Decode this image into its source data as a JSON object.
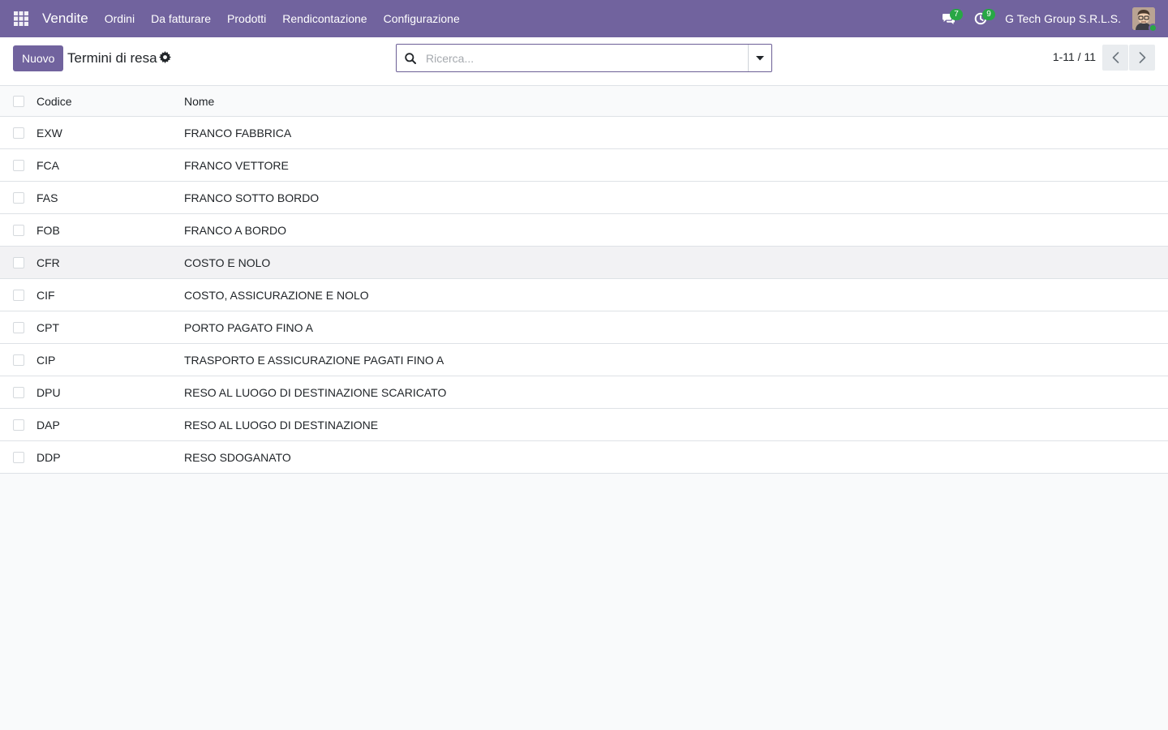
{
  "navbar": {
    "app_name": "Vendite",
    "menu": [
      "Ordini",
      "Da fatturare",
      "Prodotti",
      "Rendicontazione",
      "Configurazione"
    ],
    "messages_count": "7",
    "activities_count": "9",
    "company": "G Tech Group S.R.L.S.",
    "accent_color": "#71639e",
    "badge_color": "#28a745"
  },
  "control_panel": {
    "new_button": "Nuovo",
    "title": "Termini di resa",
    "search_placeholder": "Ricerca...",
    "pager": "1-11 / 11"
  },
  "list": {
    "columns": [
      "Codice",
      "Nome"
    ],
    "rows": [
      {
        "code": "EXW",
        "name": "FRANCO FABBRICA"
      },
      {
        "code": "FCA",
        "name": "FRANCO VETTORE"
      },
      {
        "code": "FAS",
        "name": "FRANCO SOTTO BORDO"
      },
      {
        "code": "FOB",
        "name": "FRANCO A BORDO"
      },
      {
        "code": "CFR",
        "name": "COSTO E NOLO"
      },
      {
        "code": "CIF",
        "name": "COSTO, ASSICURAZIONE E NOLO"
      },
      {
        "code": "CPT",
        "name": "PORTO PAGATO FINO A"
      },
      {
        "code": "CIP",
        "name": "TRASPORTO E ASSICURAZIONE PAGATI FINO A"
      },
      {
        "code": "DPU",
        "name": "RESO AL LUOGO DI DESTINAZIONE SCARICATO"
      },
      {
        "code": "DAP",
        "name": "RESO AL LUOGO DI DESTINAZIONE"
      },
      {
        "code": "DDP",
        "name": "RESO SDOGANATO"
      }
    ]
  }
}
